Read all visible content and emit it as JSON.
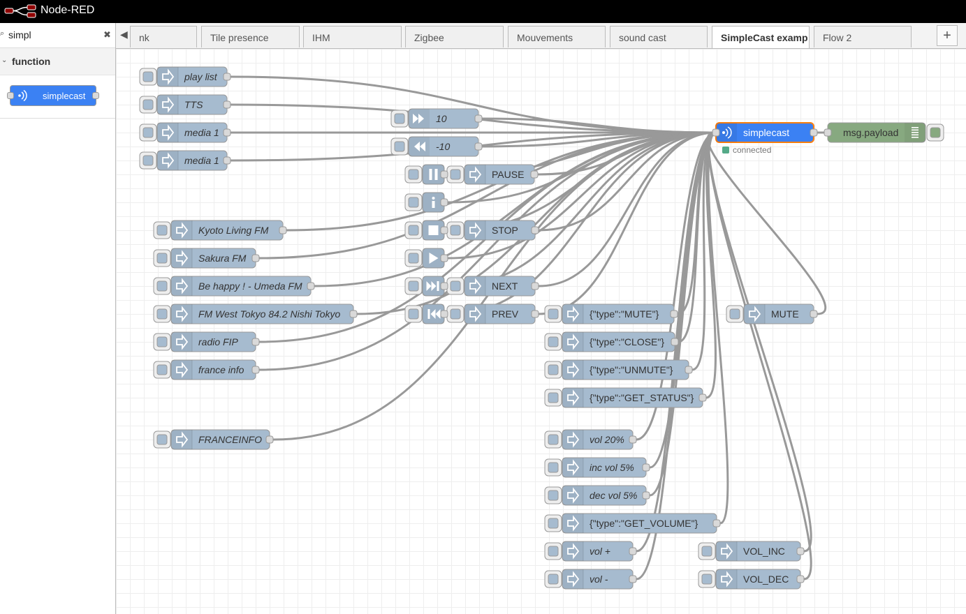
{
  "header": {
    "title": "Node-RED"
  },
  "palette": {
    "search_value": "simpl",
    "category": "function",
    "nodes": [
      {
        "label": "simplecast"
      }
    ]
  },
  "tabs": [
    {
      "label": "nk",
      "active": false
    },
    {
      "label": "Tile presence",
      "active": false
    },
    {
      "label": "IHM",
      "active": false
    },
    {
      "label": "Zigbee",
      "active": false
    },
    {
      "label": "Mouvements",
      "active": false
    },
    {
      "label": "sound cast",
      "active": false
    },
    {
      "label": "SimpleCast examp",
      "active": true
    },
    {
      "label": "Flow 2",
      "active": false
    }
  ],
  "colors": {
    "inject": "#a6bbcf",
    "simplecast": "#3b81f3",
    "selected": "#ff7f0e",
    "debug": "#87a980",
    "status_ok": "#5a8"
  },
  "flow": {
    "inject_nodes": [
      {
        "id": "playlist",
        "label": "play list",
        "italic": true
      },
      {
        "id": "tts",
        "label": "TTS",
        "italic": true
      },
      {
        "id": "media1a",
        "label": "media 1",
        "italic": true
      },
      {
        "id": "media1b",
        "label": "media 1",
        "italic": true
      },
      {
        "id": "kyoto",
        "label": "Kyoto Living FM",
        "italic": true
      },
      {
        "id": "sakura",
        "label": "Sakura FM",
        "italic": true
      },
      {
        "id": "umeda",
        "label": "Be happy ! - Umeda FM",
        "italic": true
      },
      {
        "id": "fmwest",
        "label": "FM West Tokyo 84.2 Nishi Tokyo",
        "italic": true
      },
      {
        "id": "fip",
        "label": "radio FIP",
        "italic": true
      },
      {
        "id": "finfo",
        "label": "france info",
        "italic": true
      },
      {
        "id": "franceinfo",
        "label": "FRANCEINFO",
        "italic": true
      },
      {
        "id": "pause",
        "label": "PAUSE",
        "italic": false
      },
      {
        "id": "stop",
        "label": "STOP",
        "italic": false
      },
      {
        "id": "next",
        "label": "NEXT",
        "italic": false
      },
      {
        "id": "prev",
        "label": "PREV",
        "italic": false
      },
      {
        "id": "mute_json",
        "label": "{\"type\":\"MUTE\"}",
        "italic": false
      },
      {
        "id": "close_json",
        "label": "{\"type\":\"CLOSE\"}",
        "italic": false
      },
      {
        "id": "unmute_json",
        "label": "{\"type\":\"UNMUTE\"}",
        "italic": false
      },
      {
        "id": "status_json",
        "label": "{\"type\":\"GET_STATUS\"}",
        "italic": false
      },
      {
        "id": "vol20",
        "label": "vol 20%",
        "italic": true
      },
      {
        "id": "incvol",
        "label": "inc vol 5%",
        "italic": true
      },
      {
        "id": "decvol",
        "label": "dec vol 5%",
        "italic": true
      },
      {
        "id": "volume_json",
        "label": "{\"type\":\"GET_VOLUME\"}",
        "italic": false
      },
      {
        "id": "volplus",
        "label": "vol +",
        "italic": true
      },
      {
        "id": "volminus",
        "label": "vol -",
        "italic": true
      },
      {
        "id": "mute",
        "label": "MUTE",
        "italic": false
      },
      {
        "id": "volinc",
        "label": "VOL_INC",
        "italic": false
      },
      {
        "id": "voldec",
        "label": "VOL_DEC",
        "italic": false
      }
    ],
    "ui_buttons": [
      {
        "id": "ff",
        "label": "10",
        "icon": "fast-forward-icon"
      },
      {
        "id": "rw",
        "label": "-10",
        "icon": "rewind-icon"
      },
      {
        "id": "pausebtn",
        "label": "",
        "icon": "pause-icon"
      },
      {
        "id": "infobtn",
        "label": "",
        "icon": "info-icon"
      },
      {
        "id": "stopbtn",
        "label": "",
        "icon": "stop-icon"
      },
      {
        "id": "playbtn",
        "label": "",
        "icon": "play-icon"
      },
      {
        "id": "nextbtn",
        "label": "",
        "icon": "skip-next-icon"
      },
      {
        "id": "prevbtn",
        "label": "",
        "icon": "skip-prev-icon"
      }
    ],
    "simplecast": {
      "label": "simplecast",
      "status": "connected"
    },
    "debug": {
      "label": "msg.payload"
    }
  }
}
